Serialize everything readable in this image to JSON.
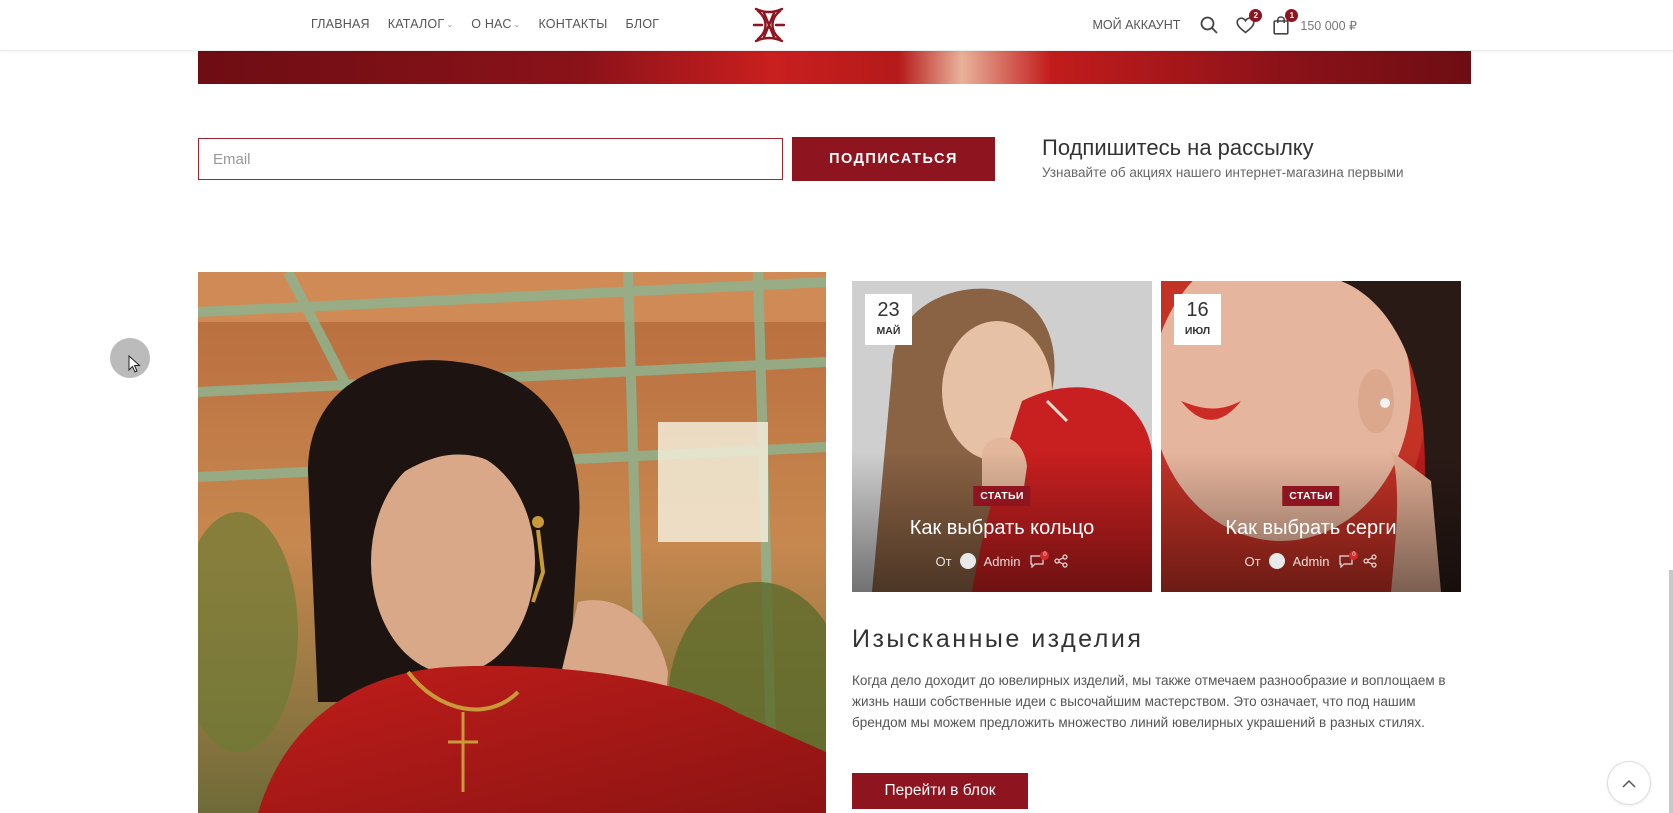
{
  "header": {
    "nav": [
      {
        "label": "ГЛАВНАЯ",
        "has_dropdown": false
      },
      {
        "label": "КАТАЛОГ",
        "has_dropdown": true
      },
      {
        "label": "О НАС",
        "has_dropdown": true
      },
      {
        "label": "КОНТАКТЫ",
        "has_dropdown": false
      },
      {
        "label": "БЛОГ",
        "has_dropdown": false
      }
    ],
    "logo_icon": "brand-monogram-logo",
    "account_label": "МОЙ АККАУНТ",
    "wishlist_count": "2",
    "cart_count": "1",
    "cart_total": "150 000 ₽"
  },
  "newsletter": {
    "email_placeholder": "Email",
    "subscribe_label": "ПОДПИСАТЬСЯ",
    "title": "Подпишитесь на рассылку",
    "subtitle": "Узнавайте об акциях нашего интернет-магазина первыми"
  },
  "posts": [
    {
      "day": "23",
      "month": "МАЙ",
      "category": "СТАТЬИ",
      "title": "Как выбрать кольцо",
      "by": "От",
      "author": "Admin",
      "comments": "0"
    },
    {
      "day": "16",
      "month": "ИЮЛ",
      "category": "СТАТЬИ",
      "title": "Как выбрать серги",
      "by": "От",
      "author": "Admin",
      "comments": "0"
    }
  ],
  "about": {
    "title": "Изысканные изделия",
    "text": "Когда дело доходит до ювелирных изделий, мы также отмечаем разнообразие и воплощаем в жизнь наши собственные идеи с высочайшим мастерством. Это означает, что под нашим брендом мы можем предложить множество линий ювелирных украшений в разных стилях.",
    "button_label": "Перейти в блок"
  },
  "colors": {
    "accent": "#8e1420",
    "text": "#333333"
  }
}
